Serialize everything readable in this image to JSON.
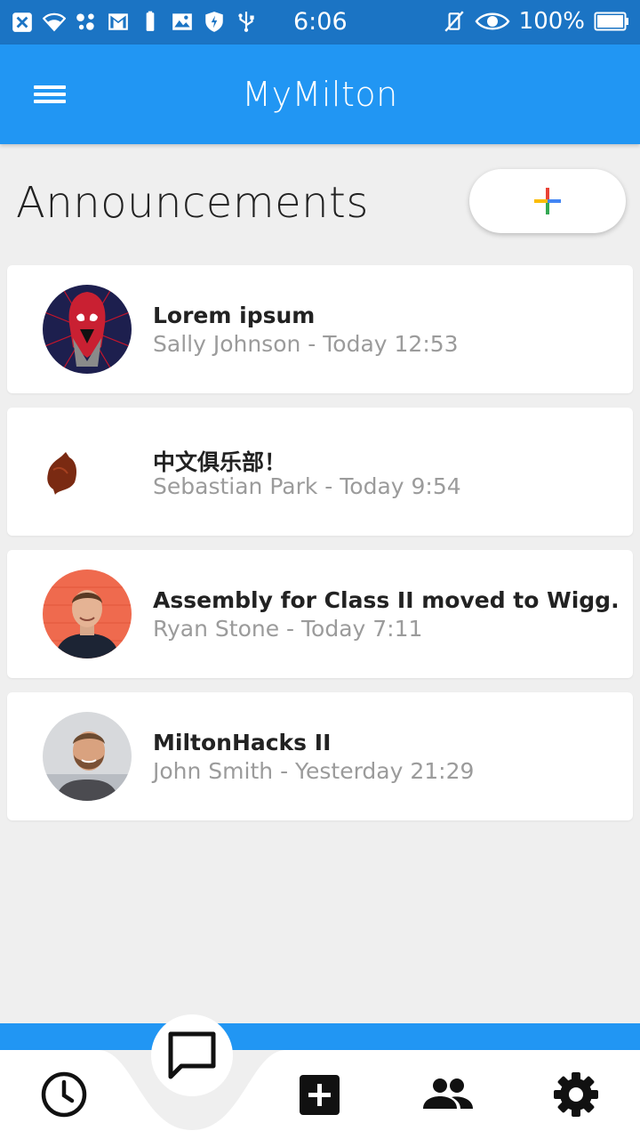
{
  "status_bar": {
    "time": "6:06",
    "battery_text": "100%",
    "left_icons": [
      "close-box-icon",
      "wifi-icon",
      "assistant-dots-icon",
      "gmail-icon",
      "battery-small-icon",
      "image-icon",
      "shield-icon",
      "usb-icon"
    ],
    "right_icons": [
      "vibrate-off-icon",
      "eye-icon",
      "battery-icon"
    ]
  },
  "app_bar": {
    "title": "MyMilton",
    "menu_icon": "hamburger-menu-icon"
  },
  "page": {
    "title": "Announcements",
    "add_button_icon": "plus-multicolor-icon"
  },
  "announcements": [
    {
      "title": "Lorem ipsum",
      "subtitle": "Sally Johnson - Today 12:53",
      "avatar": "spiderman-avatar"
    },
    {
      "title": "中文俱乐部！",
      "subtitle": "Sebastian Park - Today 9:54",
      "avatar": "leaf-avatar"
    },
    {
      "title": "Assembly for Class II moved to Wigg.",
      "subtitle": "Ryan Stone - Today 7:11",
      "avatar": "ryan-photo-avatar"
    },
    {
      "title": "MiltonHacks II",
      "subtitle": "John Smith - Yesterday 21:29",
      "avatar": "john-photo-avatar"
    }
  ],
  "bottom_nav": {
    "items": [
      "clock-icon",
      "chat-icon",
      "add-box-icon",
      "people-icon",
      "settings-gear-icon"
    ],
    "active": "chat-icon"
  },
  "colors": {
    "status_bar": "#1b74c4",
    "primary": "#2196f3",
    "background": "#efefef"
  }
}
